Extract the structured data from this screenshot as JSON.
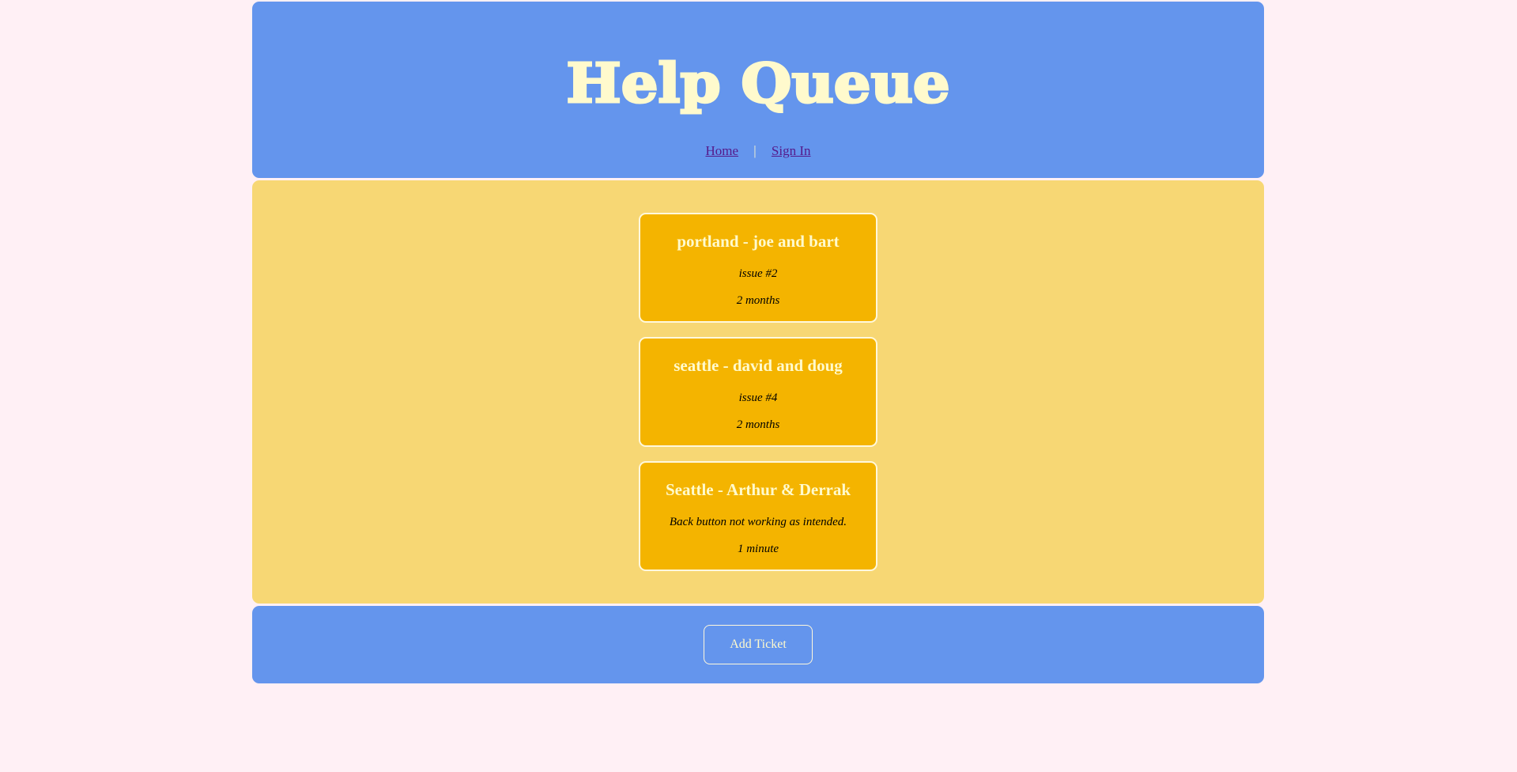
{
  "header": {
    "title": "Help Queue",
    "nav": {
      "home_label": "Home",
      "separator": "|",
      "signin_label": "Sign In"
    }
  },
  "tickets": [
    {
      "names": "portland - joe and bart",
      "issue": "issue #2",
      "time": "2 months"
    },
    {
      "names": "seattle - david and doug",
      "issue": "issue #4",
      "time": "2 months"
    },
    {
      "names": "Seattle - Arthur & Derrak",
      "issue": "Back button not working as intended.",
      "time": "1 minute"
    }
  ],
  "footer": {
    "add_ticket_label": "Add Ticket"
  },
  "colors": {
    "page_background": "#fff0f5",
    "header_background": "#6495ed",
    "queue_background": "#f7d774",
    "ticket_background": "#f4b400",
    "title_color": "#fffacd"
  }
}
